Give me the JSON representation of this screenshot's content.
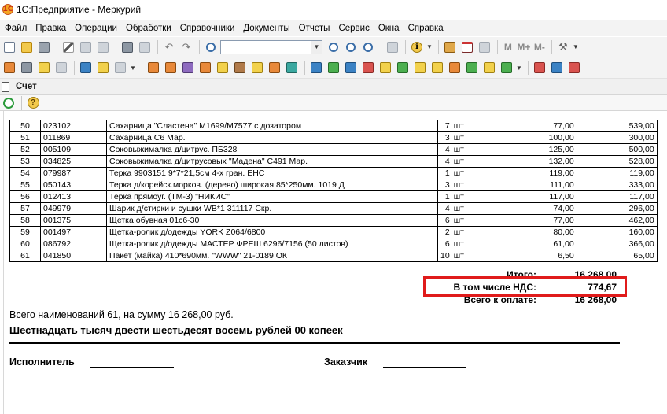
{
  "window": {
    "title": "1С:Предприятие - Меркурий",
    "logo_text": "1С"
  },
  "menu": {
    "items": [
      {
        "label": "Файл"
      },
      {
        "label": "Правка"
      },
      {
        "label": "Операции"
      },
      {
        "label": "Обработки"
      },
      {
        "label": "Справочники"
      },
      {
        "label": "Документы"
      },
      {
        "label": "Отчеты"
      },
      {
        "label": "Сервис"
      },
      {
        "label": "Окна"
      },
      {
        "label": "Справка"
      }
    ]
  },
  "toolbar": {
    "search_value": "",
    "memory_buttons": [
      "M",
      "M+",
      "M-"
    ]
  },
  "document": {
    "title": "Счет"
  },
  "table": {
    "rows": [
      {
        "n": "50",
        "code": "023102",
        "name": "Сахарница \"Сластена\" М1699/М7577 с дозатором",
        "qty": "7",
        "unit": "шт",
        "price": "77,00",
        "sum": "539,00"
      },
      {
        "n": "51",
        "code": "011869",
        "name": "Сахарница С6 Мар.",
        "qty": "3",
        "unit": "шт",
        "price": "100,00",
        "sum": "300,00"
      },
      {
        "n": "52",
        "code": "005109",
        "name": "Соковыжималка д/цитрус. ПБ328",
        "qty": "4",
        "unit": "шт",
        "price": "125,00",
        "sum": "500,00"
      },
      {
        "n": "53",
        "code": "034825",
        "name": "Соковыжималка д/цитрусовых \"Мадена\" С491 Мар.",
        "qty": "4",
        "unit": "шт",
        "price": "132,00",
        "sum": "528,00"
      },
      {
        "n": "54",
        "code": "079987",
        "name": "Терка 9903151 9*7*21,5см 4-х гран. ЕНС",
        "qty": "1",
        "unit": "шт",
        "price": "119,00",
        "sum": "119,00"
      },
      {
        "n": "55",
        "code": "050143",
        "name": "Терка д/корейск.морков. (дерево) широкая 85*250мм. 1019 Д",
        "qty": "3",
        "unit": "шт",
        "price": "111,00",
        "sum": "333,00"
      },
      {
        "n": "56",
        "code": "012413",
        "name": "Терка прямоуг. (ТМ-3) \"НИКИС\"",
        "qty": "1",
        "unit": "шт",
        "price": "117,00",
        "sum": "117,00"
      },
      {
        "n": "57",
        "code": "049979",
        "name": "Шарик д/стирки и сушки WB*1 311117 Скр.",
        "qty": "4",
        "unit": "шт",
        "price": "74,00",
        "sum": "296,00"
      },
      {
        "n": "58",
        "code": "001375",
        "name": "Щетка обувная 01с6-30",
        "qty": "6",
        "unit": "шт",
        "price": "77,00",
        "sum": "462,00"
      },
      {
        "n": "59",
        "code": "001497",
        "name": "Щетка-ролик д/одежды YORK Z064/6800",
        "qty": "2",
        "unit": "шт",
        "price": "80,00",
        "sum": "160,00"
      },
      {
        "n": "60",
        "code": "086792",
        "name": "Щетка-ролик д/одежды МАСТЕР ФРЕШ 6296/7156 (50 листов)",
        "qty": "6",
        "unit": "шт",
        "price": "61,00",
        "sum": "366,00"
      },
      {
        "n": "61",
        "code": "041850",
        "name": "Пакет (майка) 410*690мм. \"WWW\" 21-0189 ОК",
        "qty": "10",
        "unit": "шт",
        "price": "6,50",
        "sum": "65,00"
      }
    ]
  },
  "totals": {
    "total_label": "Итого:",
    "total_value": "16 268,00",
    "vat_label": "В том числе НДС:",
    "vat_value": "774,67",
    "pay_label": "Всего к оплате:",
    "pay_value": "16 268,00"
  },
  "summary": {
    "line": "Всего наименований 61, на сумму 16 268,00 руб.",
    "words": "Шестнадцать тысяч двести шестьдесят восемь рублей 00 копеек"
  },
  "signatures": {
    "executor": "Исполнитель",
    "customer": "Заказчик"
  },
  "colors": {
    "highlight": "#e01b1b"
  }
}
